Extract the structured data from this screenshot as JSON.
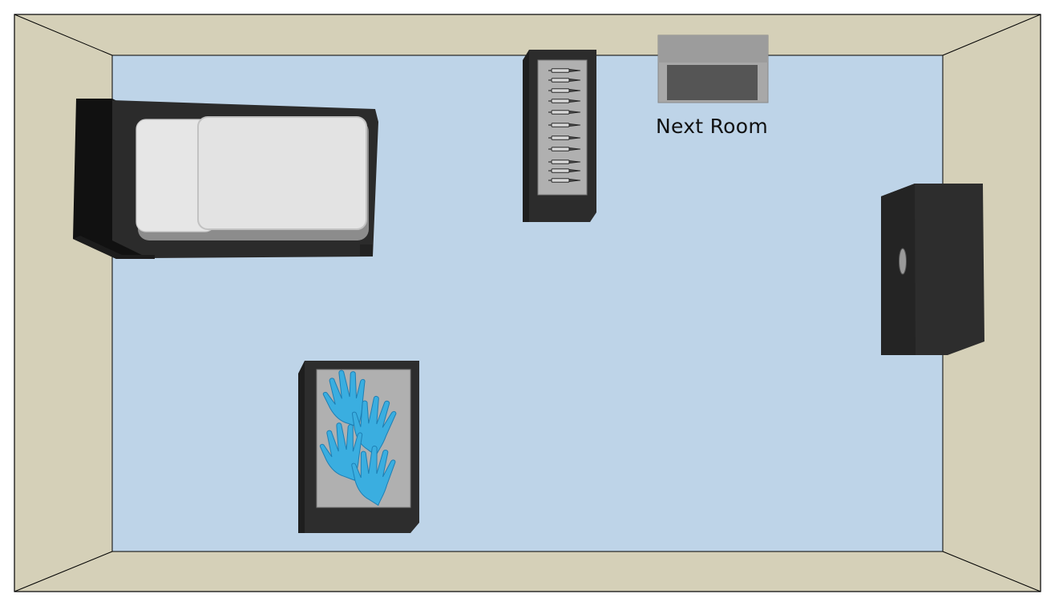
{
  "room": {
    "wall_color": "#d5d0b8",
    "floor_color": "#bed4e8",
    "outline_color": "#000000"
  },
  "door": {
    "label": "Next Room",
    "frame_color": "#a8a8a8",
    "panel_color": "#555555"
  },
  "bed": {
    "frame_color": "#2b2b2b",
    "pillow_color": "#e6e6e6",
    "sheet_color": "#e3e3e3"
  },
  "syringe_tray": {
    "syringe_count": 11,
    "tray_color": "#b0b0b0",
    "cabinet_color": "#2c2c2c"
  },
  "glove_table": {
    "glove_count": 4,
    "glove_color": "#3aaee0",
    "tray_color": "#b0b0b0"
  },
  "wardrobe": {
    "color": "#2d2d2d",
    "handle_color": "#9a9a9a"
  }
}
